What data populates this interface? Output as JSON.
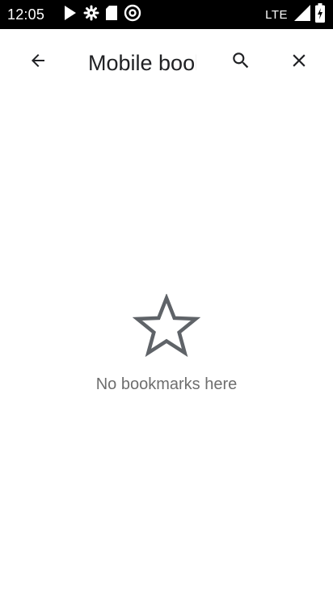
{
  "status_bar": {
    "time": "12:05",
    "network": "LTE",
    "left_icons": [
      "play-store-icon",
      "settings-icon",
      "sd-card-icon",
      "at-sign-icon"
    ],
    "right_icons": [
      "signal-icon",
      "battery-icon"
    ]
  },
  "toolbar": {
    "title": "Mobile bookmarks",
    "back_icon": "arrow-back-icon",
    "search_icon": "search-icon",
    "close_icon": "close-icon"
  },
  "empty_state": {
    "icon": "star-outline-icon",
    "message": "No bookmarks here"
  },
  "colors": {
    "status_bar_bg": "#000000",
    "background": "#ffffff",
    "title_text": "#202124",
    "empty_text": "#6e6e6e",
    "icon": "#5f6368"
  }
}
